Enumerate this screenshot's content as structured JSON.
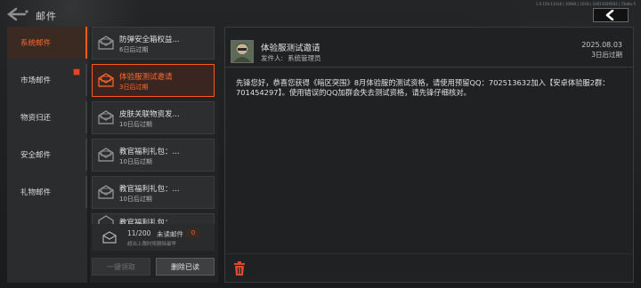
{
  "app": {
    "title": "邮件",
    "version": "1.0.159.13416 | 10904 | 1019 | 10011929563 | 73e8a-5"
  },
  "categories": [
    {
      "label": "系统邮件",
      "active": true,
      "badge": false
    },
    {
      "label": "市场邮件",
      "active": false,
      "badge": true
    },
    {
      "label": "物资归还",
      "active": false,
      "badge": false
    },
    {
      "label": "安全邮件",
      "active": false,
      "badge": false
    },
    {
      "label": "礼物邮件",
      "active": false,
      "badge": false
    }
  ],
  "mails": [
    {
      "title": "防弹安全箱权益...",
      "expire": "6日后过期",
      "active": false
    },
    {
      "title": "体验服测试邀请",
      "expire": "3日后过期",
      "active": true
    },
    {
      "title": "皮肤关联物资发...",
      "expire": "10日后过期",
      "active": false
    },
    {
      "title": "教官福利礼包：...",
      "expire": "10日后过期",
      "active": false
    },
    {
      "title": "教官福利礼包：...",
      "expire": "10日后过期",
      "active": false
    },
    {
      "title": "教官福利礼包：",
      "expire": "",
      "active": false
    }
  ],
  "summary": {
    "count": "11/200",
    "unread_label": "未读邮件",
    "unread_count": "0",
    "note": "超出上限时将删除最早"
  },
  "buttons": {
    "claim_all": "一键领取",
    "delete_read": "删除已读"
  },
  "detail": {
    "title": "体验服测试邀请",
    "sender_label": "发件人:",
    "sender": "系统管理员",
    "date": "2025.08.03",
    "expire": "3日后过期",
    "body": "先锋您好，恭喜您获得《暗区突围》8月体验服的测试资格，请使用预留QQ：702513632加入【安卓体验服2群：701454297】。使用错误的QQ加群会失去测试资格，请先锋仔细核对。"
  },
  "colors": {
    "accent": "#ff5a14",
    "badge": "#e0482c"
  }
}
